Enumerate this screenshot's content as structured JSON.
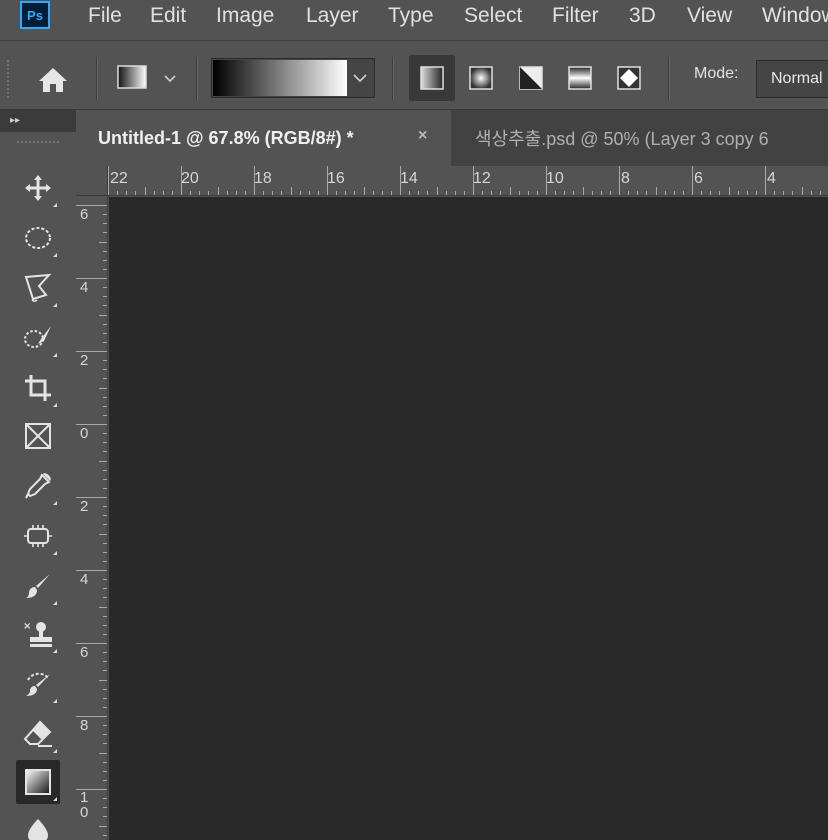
{
  "app": {
    "logo_text": "Ps",
    "accent": "#31a8ff"
  },
  "menu": {
    "items": [
      "File",
      "Edit",
      "Image",
      "Layer",
      "Type",
      "Select",
      "Filter",
      "3D",
      "View",
      "Window"
    ]
  },
  "options": {
    "home_icon": "home-icon",
    "tool_preset_icon": "gradient-preset-icon",
    "gradient_preview": [
      "#000000",
      "#ffffff"
    ],
    "gradient_types": [
      "linear",
      "radial",
      "angle",
      "reflected",
      "diamond"
    ],
    "active_gradient_type": "linear",
    "mode_label": "Mode:",
    "mode_value": "Normal"
  },
  "panel_toggle": "▸▸",
  "tools": [
    {
      "name": "move-tool",
      "icon": "move-icon"
    },
    {
      "name": "marquee-tool",
      "icon": "ellipse-marquee-icon"
    },
    {
      "name": "lasso-tool",
      "icon": "polygonal-lasso-icon"
    },
    {
      "name": "quick-selection-tool",
      "icon": "quick-selection-icon"
    },
    {
      "name": "crop-tool",
      "icon": "crop-icon"
    },
    {
      "name": "frame-tool",
      "icon": "frame-icon"
    },
    {
      "name": "eyedropper-tool",
      "icon": "eyedropper-icon"
    },
    {
      "name": "spot-healing-tool",
      "icon": "healing-bandage-icon"
    },
    {
      "name": "brush-tool",
      "icon": "brush-icon"
    },
    {
      "name": "clone-stamp-tool",
      "icon": "stamp-icon"
    },
    {
      "name": "history-brush-tool",
      "icon": "history-brush-icon"
    },
    {
      "name": "eraser-tool",
      "icon": "eraser-icon"
    },
    {
      "name": "gradient-tool",
      "icon": "gradient-icon",
      "active": true
    },
    {
      "name": "blur-tool",
      "icon": "blur-drop-icon"
    }
  ],
  "tabs": [
    {
      "title": "Untitled-1 @ 67.8% (RGB/8#) *",
      "active": true,
      "close": "×"
    },
    {
      "title": "색상추출.psd @ 50% (Layer 3 copy 6",
      "active": false
    }
  ],
  "rulers": {
    "horizontal": [
      "22",
      "20",
      "18",
      "16",
      "14",
      "12",
      "10",
      "8",
      "6",
      "4"
    ],
    "vertical": [
      "6",
      "4",
      "2",
      "0",
      "2",
      "4",
      "6",
      "8",
      "1\n0"
    ]
  },
  "colors": {
    "ui_background": "#535353",
    "canvas": "#282828",
    "tab_inactive": "#424242"
  }
}
